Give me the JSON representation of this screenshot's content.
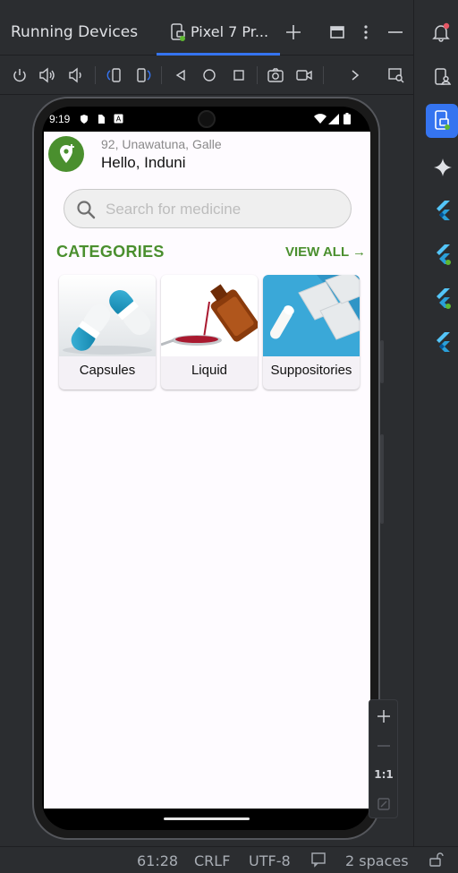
{
  "ide": {
    "panel_title": "Running Devices",
    "device_tab_label": "Pixel 7 Pr...",
    "status": {
      "position": "61:28",
      "line_ending": "CRLF",
      "encoding": "UTF-8",
      "indent": "2 spaces"
    },
    "zoom_label": "1:1"
  },
  "phone": {
    "status_time": "9:19",
    "app": {
      "address": "92, Unawatuna, Galle",
      "greeting": "Hello, Induni",
      "search_placeholder": "Search for medicine",
      "categories_title": "CATEGORIES",
      "view_all": "VIEW ALL",
      "categories": [
        {
          "label": "Capsules",
          "image": "capsules-image"
        },
        {
          "label": "Liquid",
          "image": "liquid-image"
        },
        {
          "label": "Suppositories",
          "image": "suppositories-image"
        }
      ]
    }
  },
  "colors": {
    "brand_green": "#4a8f2e",
    "ide_accent": "#3574f0",
    "ide_bg": "#2b2d30"
  }
}
